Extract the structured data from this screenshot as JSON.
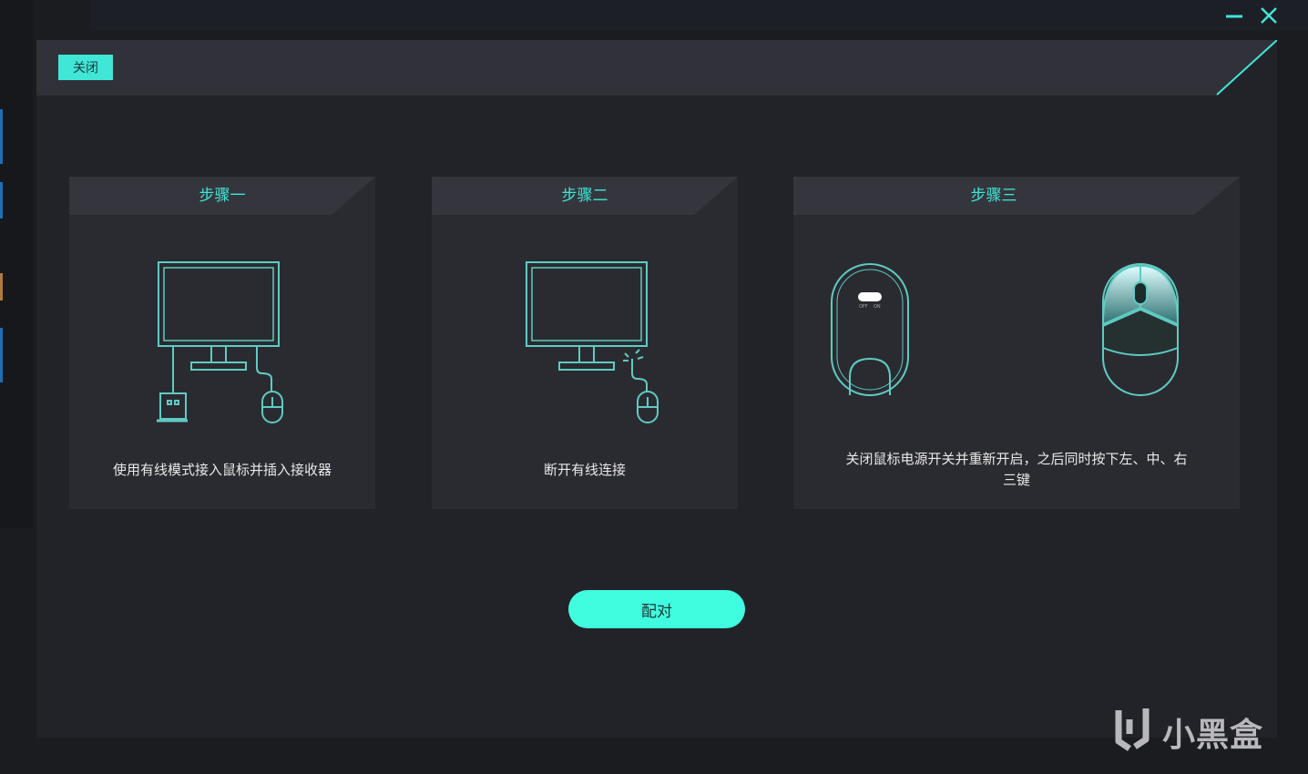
{
  "window": {
    "minimize_icon": "minimize-icon",
    "close_icon": "close-x-icon",
    "accent_color": "#40e6d6"
  },
  "dialog": {
    "close_label": "关闭",
    "pair_button_label": "配对"
  },
  "steps": [
    {
      "title": "步骤一",
      "description": "使用有线模式接入鼠标并插入接收器",
      "icon": "monitor-receiver-wired-mouse-illustration"
    },
    {
      "title": "步骤二",
      "description": "断开有线连接",
      "icon": "monitor-disconnect-cable-illustration"
    },
    {
      "title": "步骤三",
      "description_line1": "关闭鼠标电源开关并重新开启，之后同时按下左、中、右",
      "description_line2": "三键",
      "icon": "mouse-power-switch-and-buttons-illustration"
    }
  ],
  "mouse_switch": {
    "off_label": "OFF",
    "on_label": "ON"
  },
  "watermark": {
    "text": "小黑盒"
  }
}
